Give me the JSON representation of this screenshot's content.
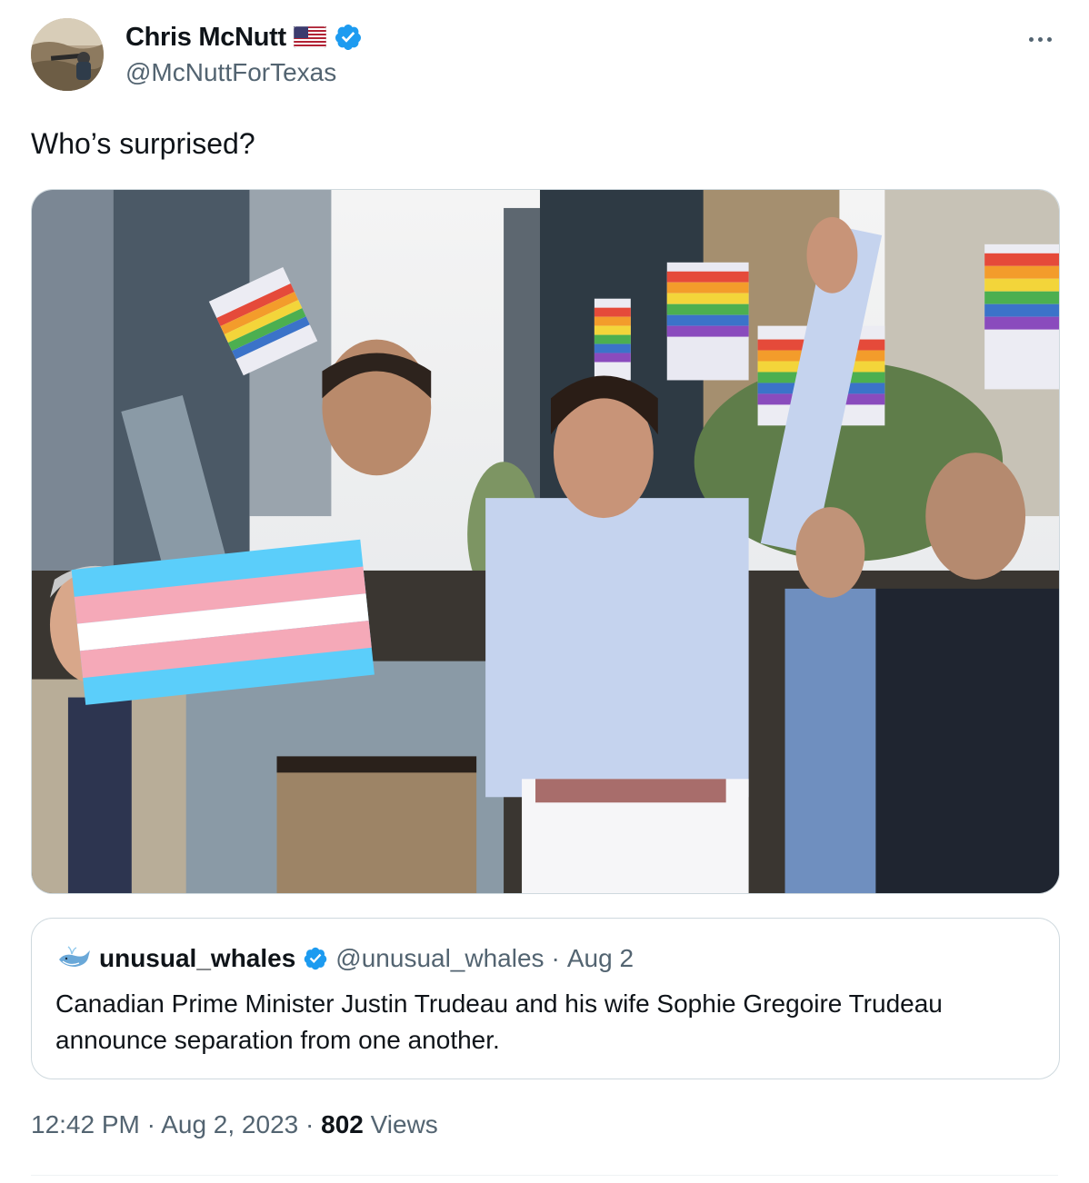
{
  "author": {
    "display_name": "Chris McNutt",
    "handle": "@McNuttForTexas",
    "flag_icon": "us-flag-emoji",
    "verified_icon": "verified-badge-icon",
    "verified_color": "#1d9bf0"
  },
  "tweet": {
    "text": "Who’s surprised?",
    "more_icon": "more-horizontal-icon"
  },
  "media": {
    "type": "photo"
  },
  "quote": {
    "avatar_icon": "whale-icon",
    "display_name": "unusual_whales",
    "handle": "@unusual_whales",
    "separator": "·",
    "date": "Aug 2",
    "text": "Canadian Prime Minister Justin Trudeau and his wife Sophie Gregoire Trudeau announce separation from one another."
  },
  "footer": {
    "time": "12:42 PM",
    "date": "Aug 2, 2023",
    "separator": "·",
    "views_count": "802",
    "views_label": "Views"
  },
  "colors": {
    "text_primary": "#0f1419",
    "text_secondary": "#536471",
    "border": "#cfd9de"
  }
}
